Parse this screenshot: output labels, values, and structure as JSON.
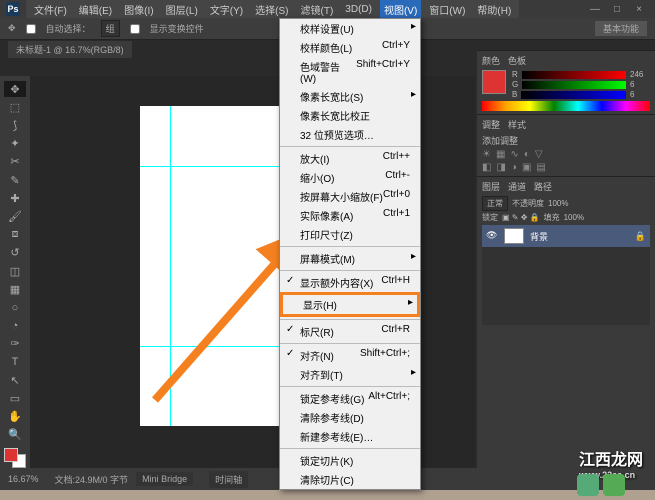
{
  "app_logo": "Ps",
  "menubar": [
    "文件(F)",
    "编辑(E)",
    "图像(I)",
    "图层(L)",
    "文字(Y)",
    "选择(S)",
    "滤镜(T)",
    "3D(D)",
    "视图(V)",
    "窗口(W)",
    "帮助(H)"
  ],
  "menubar_active_index": 8,
  "optionbar": {
    "autoselect": "自动选择：",
    "group": "组",
    "showtransform": "显示变换控件"
  },
  "workspace_btn": "基本功能",
  "doc_tab": "未标题-1 @ 16.7%(RGB/8)",
  "dropdown": [
    {
      "t": "校样设置(U)",
      "s": "▸"
    },
    {
      "t": "校样颜色(L)",
      "k": "Ctrl+Y"
    },
    {
      "t": "色域警告(W)",
      "k": "Shift+Ctrl+Y"
    },
    {
      "t": "像素长宽比(S)",
      "s": "▸"
    },
    {
      "t": "像素长宽比校正"
    },
    {
      "t": "32 位预览选项…"
    },
    {
      "sep": true
    },
    {
      "t": "放大(I)",
      "k": "Ctrl++"
    },
    {
      "t": "缩小(O)",
      "k": "Ctrl+-"
    },
    {
      "t": "按屏幕大小缩放(F)",
      "k": "Ctrl+0"
    },
    {
      "t": "实际像素(A)",
      "k": "Ctrl+1"
    },
    {
      "t": "打印尺寸(Z)"
    },
    {
      "sep": true
    },
    {
      "t": "屏幕模式(M)",
      "s": "▸"
    },
    {
      "sep": true
    },
    {
      "t": "显示额外内容(X)",
      "k": "Ctrl+H",
      "chk": true
    },
    {
      "t": "显示(H)",
      "s": "▸",
      "hl": true
    },
    {
      "sep": true
    },
    {
      "t": "标尺(R)",
      "k": "Ctrl+R",
      "chk": true
    },
    {
      "sep": true
    },
    {
      "t": "对齐(N)",
      "k": "Shift+Ctrl+;",
      "chk": true
    },
    {
      "t": "对齐到(T)",
      "s": "▸"
    },
    {
      "sep": true
    },
    {
      "t": "锁定参考线(G)",
      "k": "Alt+Ctrl+;"
    },
    {
      "t": "清除参考线(D)"
    },
    {
      "t": "新建参考线(E)…"
    },
    {
      "sep": true
    },
    {
      "t": "锁定切片(K)"
    },
    {
      "t": "清除切片(C)"
    }
  ],
  "panels": {
    "color_tab1": "颜色",
    "color_tab2": "色板",
    "r_label": "R",
    "g_label": "G",
    "b_label": "B",
    "r_val": "246",
    "g_val": "6",
    "b_val": "6",
    "adjust_tab1": "调整",
    "adjust_tab2": "样式",
    "addadj": "添加调整",
    "layers_tab1": "图层",
    "layers_tab2": "通道",
    "layers_tab3": "路径",
    "normal": "正常",
    "opacity_lbl": "不透明度",
    "opacity_val": "100%",
    "lock_lbl": "锁定",
    "fill_lbl": "填充",
    "fill_val": "100%",
    "layer_bg": "背景"
  },
  "status": {
    "zoom": "16.67%",
    "doc": "文档:24.9M/0 字节",
    "minibridge": "Mini Bridge",
    "timeline": "时间轴"
  },
  "watermark": {
    "title": "江西龙网",
    "url": "www.22ee.cn"
  }
}
